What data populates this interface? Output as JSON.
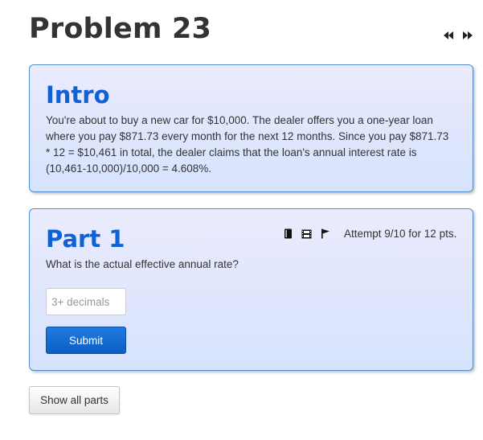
{
  "page": {
    "title": "Problem 23"
  },
  "nav": {
    "previous_icon": "double-chevron-left-icon",
    "next_icon": "double-chevron-right-icon"
  },
  "intro": {
    "heading": "Intro",
    "text": "You're about to buy a new car for $10,000. The dealer offers you a one-year loan where you pay $871.73 every month for the next 12 months. Since you pay $871.73 * 12 = $10,461 in total, the dealer claims that the loan's annual interest rate is (10,461-10,000)/10,000 = 4.608%."
  },
  "part1": {
    "heading": "Part 1",
    "question": "What is the actual effective annual rate?",
    "attempt": "Attempt 9/10 for 12 pts.",
    "icons": [
      "book-icon",
      "film-icon",
      "flag-icon"
    ],
    "input": {
      "placeholder": "3+ decimals",
      "value": ""
    },
    "submit_label": "Submit"
  },
  "footer": {
    "show_all_label": "Show all parts"
  },
  "colors": {
    "heading_blue": "#1060d6",
    "panel_border": "#4d8cd0",
    "panel_bg_top": "#ebebfd",
    "panel_bg_bottom": "#d6e3fd",
    "submit_bg": "#0c5fc4"
  }
}
